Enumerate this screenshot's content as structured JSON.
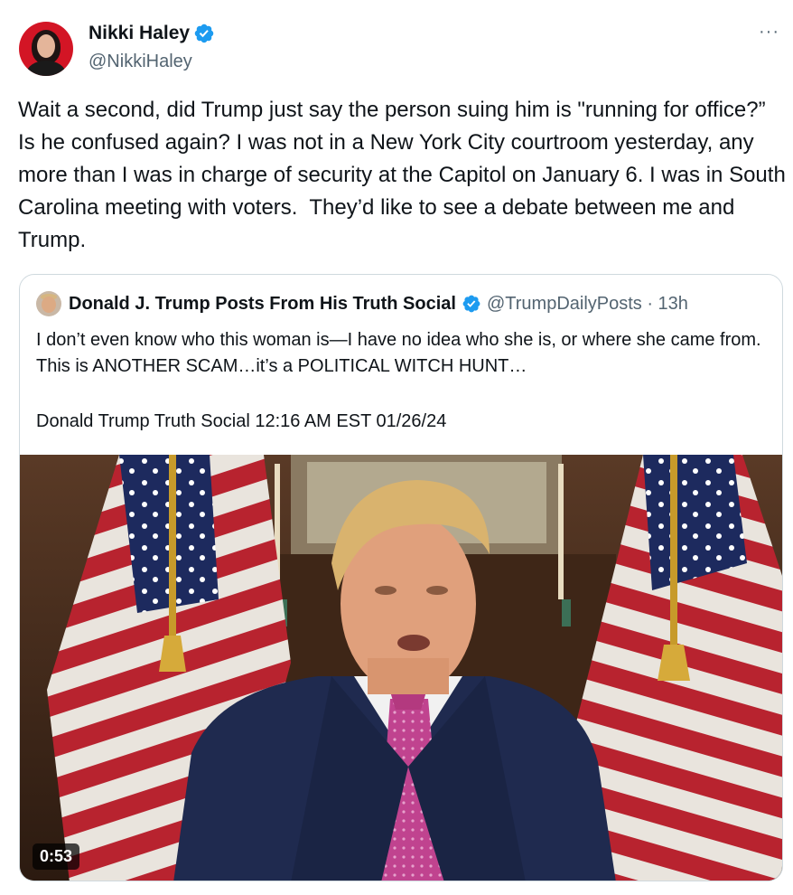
{
  "tweet": {
    "author_name": "Nikki Haley",
    "handle": "@NikkiHaley",
    "more_label": "···",
    "text": "Wait a second, did Trump just say the person suing him is \"running for office?” Is he confused again? I was not in a New York City courtroom yesterday, any more than I was in charge of security at the Capitol on January 6. I was in South Carolina meeting with voters.  They’d like to see a debate between me and Trump."
  },
  "quote": {
    "author_name": "Donald J. Trump Posts From His Truth Social",
    "meta": "@TrumpDailyPosts · 13h",
    "text": "I don’t even know who this woman is—I have no idea who she is, or where she came from. This is ANOTHER SCAM…it’s a POLITICAL WITCH HUNT…",
    "signature": "Donald Trump Truth Social 12:16 AM EST 01/26/24",
    "video_duration": "0:53"
  },
  "colors": {
    "verified_blue": "#1d9bf0",
    "secondary_text": "#536471",
    "border": "#cfd9de"
  },
  "icons": {
    "verified": "verified-badge-icon",
    "more": "more-options-icon"
  }
}
